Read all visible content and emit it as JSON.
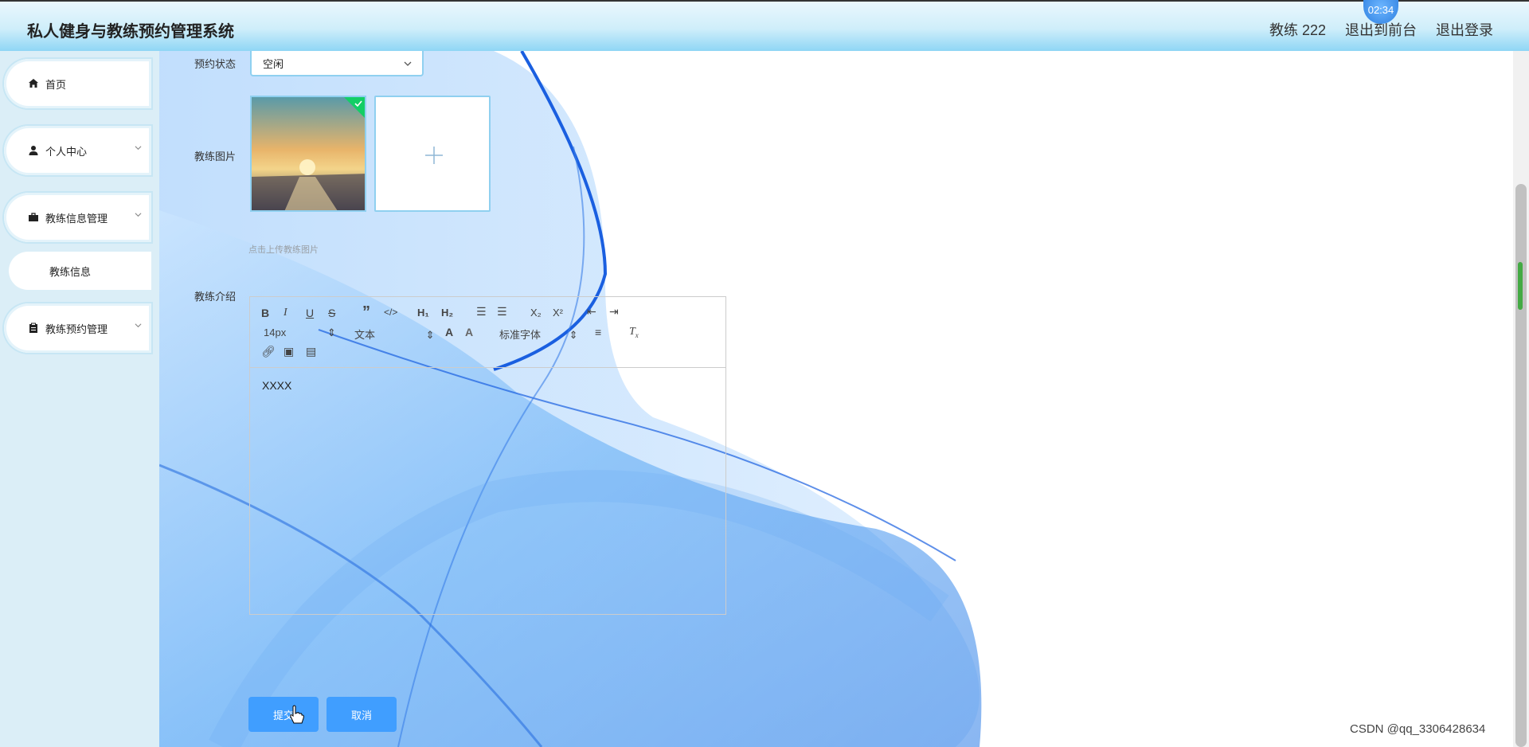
{
  "app": {
    "title": "私人健身与教练预约管理系统",
    "timer": "02:34"
  },
  "header": {
    "user": "教练 222",
    "back_front": "退出到前台",
    "logout": "退出登录"
  },
  "sidebar": {
    "items": [
      {
        "label": "首页",
        "icon": "home-icon"
      },
      {
        "label": "个人中心",
        "icon": "user-icon"
      },
      {
        "label": "教练信息管理",
        "icon": "briefcase-icon"
      },
      {
        "label": "教练预约管理",
        "icon": "clipboard-icon"
      }
    ],
    "sub_item": "教练信息"
  },
  "form": {
    "status_label": "预约状态",
    "status_value": "空闲",
    "image_label": "教练图片",
    "upload_hint": "点击上传教练图片",
    "intro_label": "教练介绍",
    "intro_content": "XXXX",
    "font_size": "14px",
    "text_type": "文本",
    "font_family": "标准字体",
    "submit": "提交",
    "cancel": "取消"
  },
  "watermark": "CSDN @qq_3306428634",
  "colors": {
    "primary": "#409eff",
    "border": "#8fd0f0",
    "success": "#13ce66"
  }
}
